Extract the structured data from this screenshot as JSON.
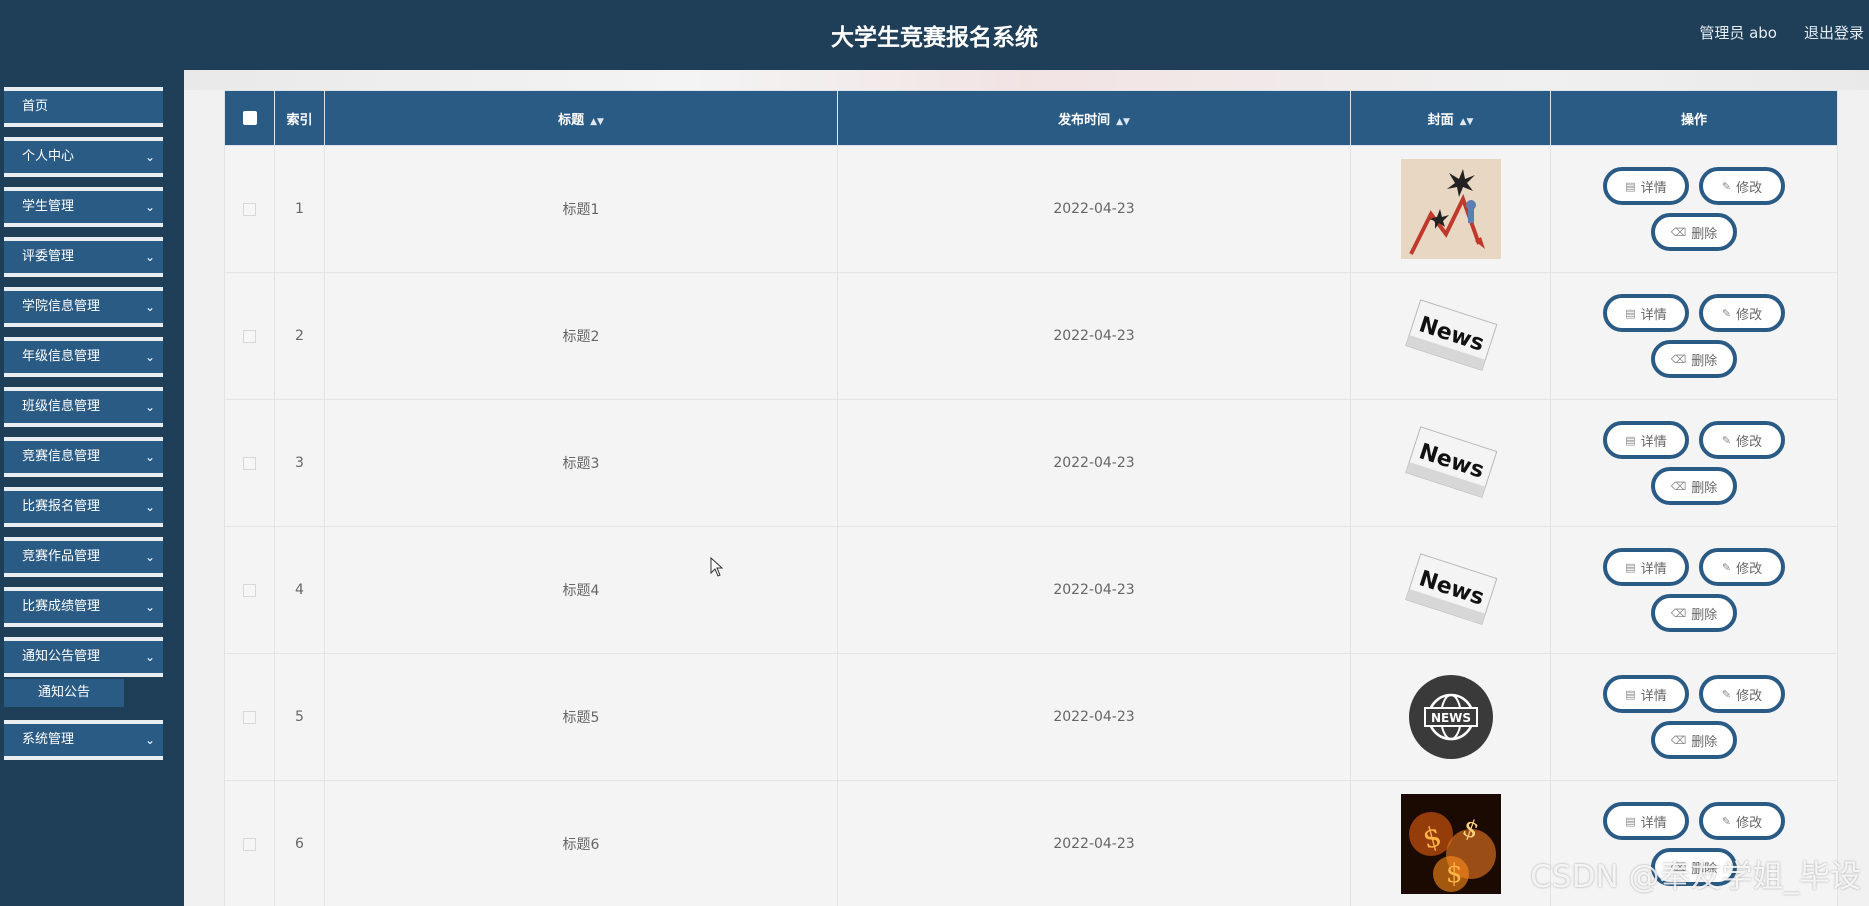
{
  "header": {
    "title": "大学生竞赛报名系统",
    "user": "管理员 abo",
    "logout": "退出登录"
  },
  "sidebar": {
    "items": [
      {
        "label": "首页",
        "expandable": false
      },
      {
        "label": "个人中心",
        "expandable": true
      },
      {
        "label": "学生管理",
        "expandable": true
      },
      {
        "label": "评委管理",
        "expandable": true
      },
      {
        "label": "学院信息管理",
        "expandable": true
      },
      {
        "label": "年级信息管理",
        "expandable": true
      },
      {
        "label": "班级信息管理",
        "expandable": true
      },
      {
        "label": "竞赛信息管理",
        "expandable": true
      },
      {
        "label": "比赛报名管理",
        "expandable": true
      },
      {
        "label": "竞赛作品管理",
        "expandable": true
      },
      {
        "label": "比赛成绩管理",
        "expandable": true
      },
      {
        "label": "通知公告管理",
        "expandable": true
      },
      {
        "label": "系统管理",
        "expandable": true
      }
    ],
    "submenu": {
      "label": "通知公告"
    }
  },
  "table": {
    "columns": {
      "index": "索引",
      "title": "标题",
      "date": "发布时间",
      "cover": "封面",
      "ops": "操作"
    },
    "buttons": {
      "detail": "详情",
      "edit": "修改",
      "delete": "删除"
    },
    "rows": [
      {
        "index": "1",
        "title": "标题1",
        "date": "2022-04-23",
        "cover": "chart-cover-icon"
      },
      {
        "index": "2",
        "title": "标题2",
        "date": "2022-04-23",
        "cover": "newspaper-cover-icon"
      },
      {
        "index": "3",
        "title": "标题3",
        "date": "2022-04-23",
        "cover": "newspaper-cover-icon"
      },
      {
        "index": "4",
        "title": "标题4",
        "date": "2022-04-23",
        "cover": "newspaper-cover-icon"
      },
      {
        "index": "5",
        "title": "标题5",
        "date": "2022-04-23",
        "cover": "globe-news-cover-icon"
      },
      {
        "index": "6",
        "title": "标题6",
        "date": "2022-04-23",
        "cover": "fire-money-cover-icon"
      }
    ]
  },
  "cover_art": {
    "news": "News",
    "news_upper": "NEWS"
  },
  "watermark": "CSDN @奉友学姐_毕设",
  "colors": {
    "header_bg": "#1f3e57",
    "accent": "#2a5b85",
    "table_bg": "#f4f4f4"
  }
}
